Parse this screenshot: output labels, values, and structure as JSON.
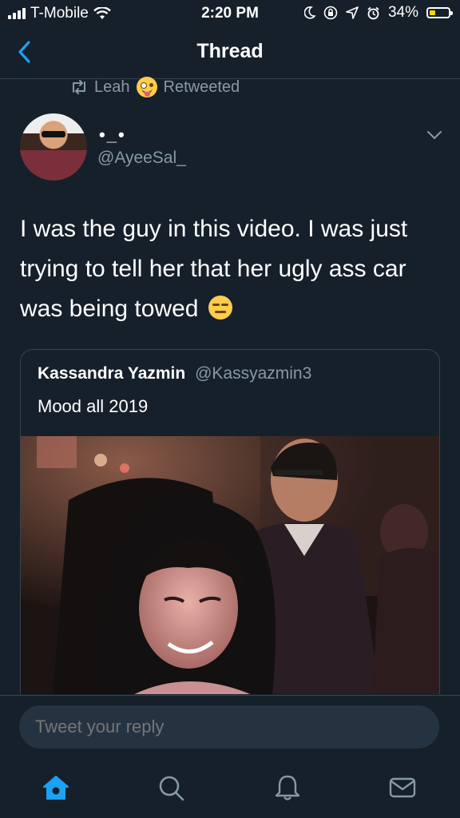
{
  "status_bar": {
    "carrier": "T-Mobile",
    "time": "2:20 PM",
    "battery_percent": "34%",
    "battery_level": 0.34,
    "icons": [
      "signal-icon",
      "wifi-icon",
      "moon-icon",
      "rotation-lock-icon",
      "location-icon",
      "alarm-icon",
      "battery-icon"
    ]
  },
  "nav": {
    "back_icon": "chevron-left-icon",
    "title": "Thread"
  },
  "retweet_context": {
    "icon": "retweet-icon",
    "name": "Leah",
    "emoji": "zany-face-emoji",
    "label": "Retweeted"
  },
  "tweet": {
    "author_name": "•_•",
    "author_handle": "@AyeeSal_",
    "text": "I was the guy in this video. I was just trying to tell her that her ugly ass car was being towed",
    "emoji": "expressionless-face-emoji",
    "menu_icon": "chevron-down-icon"
  },
  "quoted_tweet": {
    "author_name": "Kassandra Yazmin",
    "author_handle": "@Kassyazmin3",
    "text": "Mood all 2019",
    "media": "video-thumbnail"
  },
  "reply": {
    "placeholder": "Tweet your reply"
  },
  "tab_bar": {
    "items": [
      "home-icon",
      "search-icon",
      "notifications-icon",
      "messages-icon"
    ],
    "active": "home-icon"
  },
  "colors": {
    "background": "#15202b",
    "accent": "#1da1f2",
    "secondary_text": "#8899a6",
    "border": "#38444d",
    "input_background": "#253341"
  }
}
